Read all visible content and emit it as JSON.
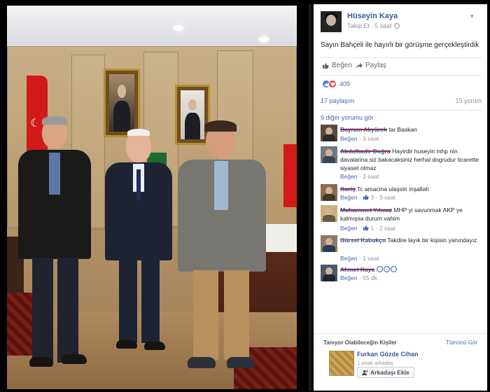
{
  "post": {
    "author": "Hüseyin Kaya",
    "follow": "Takip Et",
    "time": "5 saat",
    "text": "Sayın Bahçeli ile hayırlı bir görüşme gerçekleştirdik",
    "like_label": "Beğen",
    "share_label": "Paylaş",
    "reaction_count": "409",
    "shares": "17 paylaşım",
    "comments_count": "15 yorum",
    "more_comments": "9 diğer yorumu gör"
  },
  "comments": [
    {
      "name": "Bayram Akyürek",
      "text": "tar Baskan",
      "like": "Beğen",
      "likes": "",
      "time": "3 saat"
    },
    {
      "name": "Abdulkadir Doğru",
      "text": "Hayirdir huseyin mhp nin davalarina siz bakacaksiniz herhal dogrudur ticarette siyaset olmaz",
      "like": "Beğen",
      "likes": "",
      "time": "3 saat"
    },
    {
      "name": "Kuriş",
      "text": "Tc amacina ulaşsin inşallah",
      "like": "Beğen",
      "likes": "3",
      "time": "3 saat"
    },
    {
      "name": "Muhammet Yılmaz",
      "text": "MHP yi savunmak AKP ye kalmışsa durum vahim",
      "like": "Beğen",
      "likes": "1",
      "time": "2 saat"
    },
    {
      "name": "Gürsel Kabukçu",
      "text": "Takdire layık bir kişisin yanındayız",
      "like": "Beğen",
      "likes": "",
      "time": "1 saat"
    },
    {
      "name": "Ahmet Kaya",
      "text": "",
      "like": "Beğen",
      "likes": "",
      "time": "55 dk"
    }
  ],
  "pymk": {
    "title": "Tanıyor Olabileceğin Kişiler",
    "see_all": "Tümünü Gör",
    "name": "Furkan Gözde Cihan",
    "mutual": "1 ortak arkadaş",
    "add": "Arkadaşı Ekle"
  },
  "colors": {
    "facebook_blue": "#4267b2",
    "link": "#365899",
    "meta_gray": "#90949c",
    "love": "#ef4b5e"
  },
  "icons": [
    "globe-icon",
    "chevron-down-icon",
    "like-icon",
    "share-icon",
    "thumbs-up-icon",
    "heart-icon",
    "add-friend-icon",
    "emoji-icon"
  ]
}
